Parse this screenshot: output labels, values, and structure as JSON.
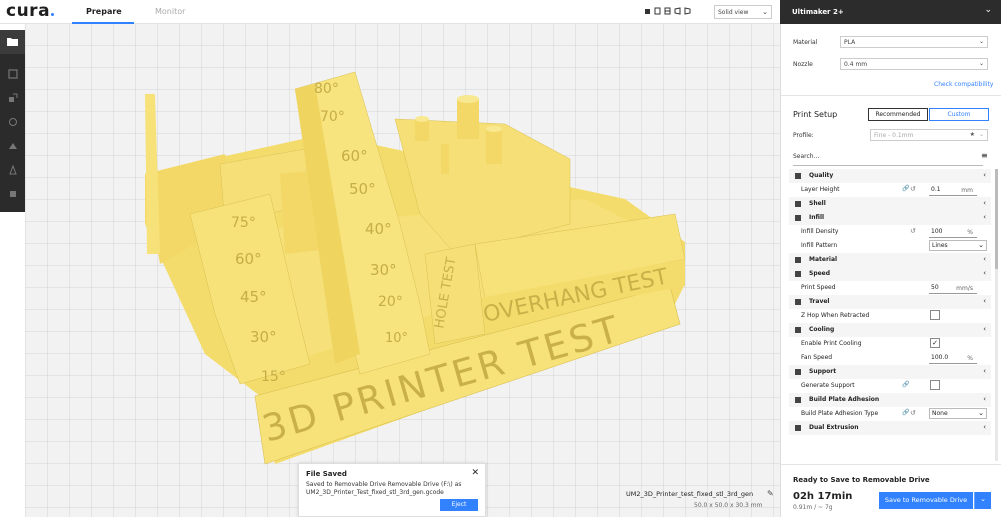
{
  "app": {
    "logo": "cura"
  },
  "tabs": [
    {
      "label": "Prepare"
    },
    {
      "label": "Monitor"
    }
  ],
  "view": {
    "mode": "Solid view"
  },
  "machine": {
    "name": "Ultimaker 2+"
  },
  "material": {
    "label": "Material",
    "value": "PLA"
  },
  "nozzle": {
    "label": "Nozzle",
    "value": "0.4 mm"
  },
  "compat_link": "Check compatibility",
  "print_setup": {
    "title": "Print Setup",
    "recommended": "Recommended",
    "custom": "Custom",
    "profile_label": "Profile:",
    "profile_value": "Fine - 0.1mm",
    "search_placeholder": "Search..."
  },
  "settings": [
    {
      "type": "cat",
      "label": "Quality",
      "icon": "quality-icon"
    },
    {
      "type": "val",
      "label": "Layer Height",
      "value": "0.1",
      "unit": "mm",
      "link": true,
      "reset": true
    },
    {
      "type": "cat",
      "label": "Shell",
      "icon": "shell-icon"
    },
    {
      "type": "cat",
      "label": "Infill",
      "icon": "infill-icon"
    },
    {
      "type": "val",
      "label": "Infill Density",
      "value": "100",
      "unit": "%",
      "reset": true
    },
    {
      "type": "dd",
      "label": "Infill Pattern",
      "value": "Lines"
    },
    {
      "type": "cat",
      "label": "Material",
      "icon": "material-icon"
    },
    {
      "type": "cat",
      "label": "Speed",
      "icon": "speed-icon"
    },
    {
      "type": "val",
      "label": "Print Speed",
      "value": "50",
      "unit": "mm/s"
    },
    {
      "type": "cat",
      "label": "Travel",
      "icon": "travel-icon"
    },
    {
      "type": "check",
      "label": "Z Hop When Retracted",
      "checked": ""
    },
    {
      "type": "cat",
      "label": "Cooling",
      "icon": "cooling-icon"
    },
    {
      "type": "check",
      "label": "Enable Print Cooling",
      "checked": "✓"
    },
    {
      "type": "val",
      "label": "Fan Speed",
      "value": "100.0",
      "unit": "%"
    },
    {
      "type": "cat",
      "label": "Support",
      "icon": "support-icon"
    },
    {
      "type": "check",
      "label": "Generate Support",
      "checked": "",
      "link": true
    },
    {
      "type": "cat",
      "label": "Build Plate Adhesion",
      "icon": "adhesion-icon"
    },
    {
      "type": "dd",
      "label": "Build Plate Adhesion Type",
      "value": "None",
      "link": true,
      "reset": true
    },
    {
      "type": "cat",
      "label": "Dual Extrusion",
      "icon": "dual-extrusion-icon"
    }
  ],
  "output": {
    "status": "Ready to Save to Removable Drive",
    "time": "02h 17min",
    "material_usage": "0.91m / ~ 7g",
    "save_button": "Save to Removable Drive"
  },
  "toast": {
    "title": "File Saved",
    "message": "Saved to Removable Drive Removable Drive (F:\\) as UM2_3D_Printer_Test_fixed_stl_3rd_gen.gcode",
    "button": "Eject"
  },
  "object": {
    "filename": "UM2_3D_Printer_test_fixed_stl_3rd_gen",
    "dimensions": "50.0 x 50.0 x 30.3 mm"
  },
  "model_text": {
    "main": "3D PRINTER TEST",
    "overhang": "OVERHANG TEST",
    "hole": "HOLE TEST",
    "arc_right": [
      "80°",
      "70°",
      "60°",
      "50°",
      "40°",
      "30°",
      "20°",
      "10°"
    ],
    "arc_left": [
      "75°",
      "60°",
      "45°",
      "30°",
      "15°"
    ]
  },
  "colors": {
    "accent": "#3282ff",
    "model": "#f7e27a",
    "dark": "#2c2c2c"
  }
}
